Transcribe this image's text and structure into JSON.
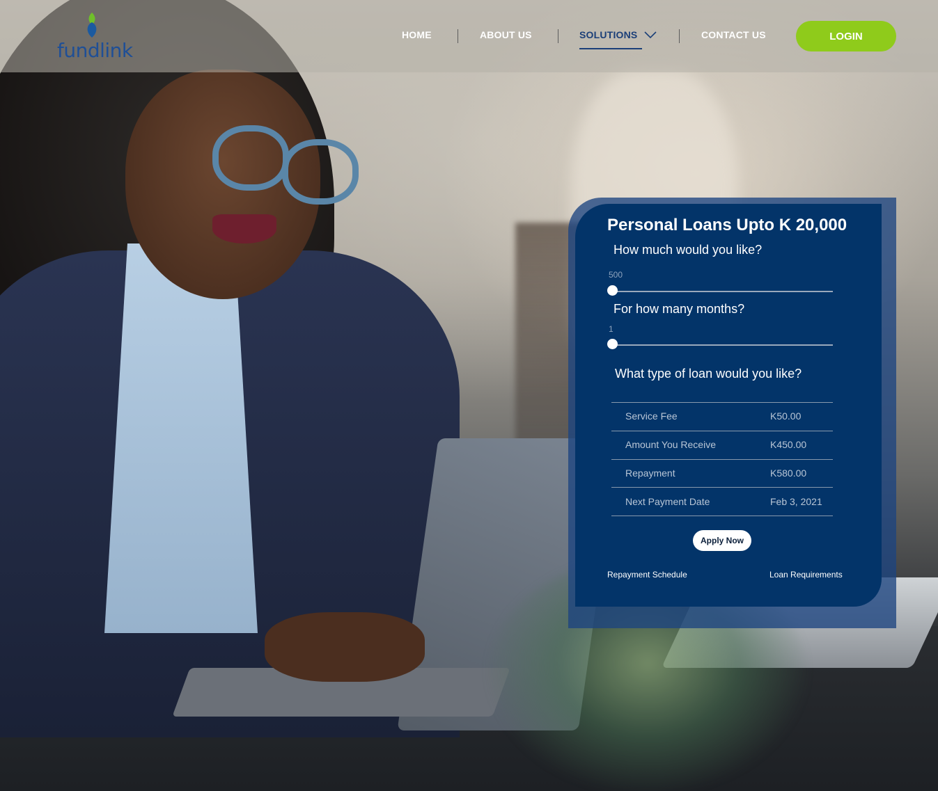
{
  "brand": {
    "name": "fundlink",
    "color": "#1f4f96",
    "leaf_colors": [
      "#6fbf2a",
      "#1b5aa0"
    ]
  },
  "nav": {
    "items": [
      "HOME",
      "ABOUT US",
      "SOLUTIONS",
      "CONTACT US"
    ],
    "active": "SOLUTIONS",
    "login": "LOGIN"
  },
  "colors": {
    "accent": "#8fcb1b",
    "card": "#033469",
    "nav_active": "#1b3f78"
  },
  "loan_card": {
    "title": "Personal Loans Upto K 20,000",
    "amount_question": "How much would you like?",
    "amount_value": "500",
    "amount_slider_fraction": 0,
    "months_question": "For how many months?",
    "months_value": "1",
    "months_slider_fraction": 0,
    "type_question": "What type of loan would you like?",
    "summary": [
      {
        "label": "Service Fee",
        "value": "K50.00"
      },
      {
        "label": "Amount You Receive",
        "value": "K450.00"
      },
      {
        "label": "Repayment",
        "value": "K580.00"
      },
      {
        "label": "Next Payment Date",
        "value": "Feb 3, 2021"
      }
    ],
    "apply_label": "Apply Now",
    "links": {
      "repayment_schedule": "Repayment Schedule",
      "loan_requirements": "Loan Requirements"
    }
  }
}
